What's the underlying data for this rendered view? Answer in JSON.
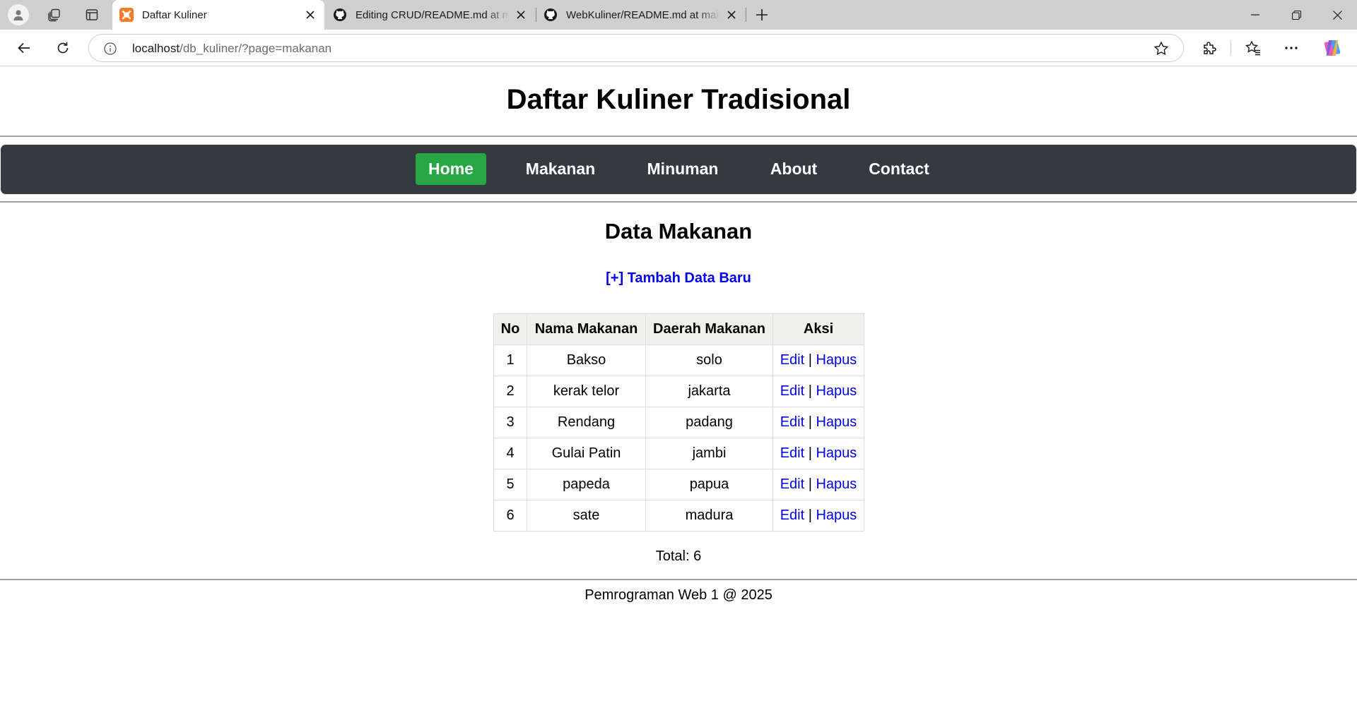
{
  "browser": {
    "tabs": [
      {
        "title": "Daftar Kuliner",
        "favicon": "xampp-icon",
        "active": true
      },
      {
        "title": "Editing CRUD/README.md at main",
        "favicon": "github-icon",
        "active": false
      },
      {
        "title": "WebKuliner/README.md at main",
        "favicon": "github-icon",
        "active": false
      }
    ],
    "url": {
      "host": "localhost",
      "path": "/db_kuliner/?page=makanan"
    }
  },
  "site": {
    "title": "Daftar Kuliner Tradisional"
  },
  "nav": {
    "items": [
      {
        "label": "Home",
        "active": true
      },
      {
        "label": "Makanan",
        "active": false
      },
      {
        "label": "Minuman",
        "active": false
      },
      {
        "label": "About",
        "active": false
      },
      {
        "label": "Contact",
        "active": false
      }
    ]
  },
  "colors": {
    "nav_bg": "#343a40",
    "nav_active": "#28a745",
    "link": "#0000ee"
  },
  "main": {
    "heading": "Data Makanan",
    "add_link": "[+] Tambah Data Baru",
    "table": {
      "headers": [
        "No",
        "Nama Makanan",
        "Daerah Makanan",
        "Aksi"
      ],
      "rows": [
        {
          "no": "1",
          "nama": "Bakso",
          "daerah": "solo"
        },
        {
          "no": "2",
          "nama": "kerak telor",
          "daerah": "jakarta"
        },
        {
          "no": "3",
          "nama": "Rendang",
          "daerah": "padang"
        },
        {
          "no": "4",
          "nama": "Gulai Patin",
          "daerah": "jambi"
        },
        {
          "no": "5",
          "nama": "papeda",
          "daerah": "papua"
        },
        {
          "no": "6",
          "nama": "sate",
          "daerah": "madura"
        }
      ],
      "edit_label": "Edit",
      "separator": "|",
      "delete_label": "Hapus"
    },
    "total": "Total: 6"
  },
  "footer": {
    "text": "Pemrograman Web 1 @ 2025"
  }
}
